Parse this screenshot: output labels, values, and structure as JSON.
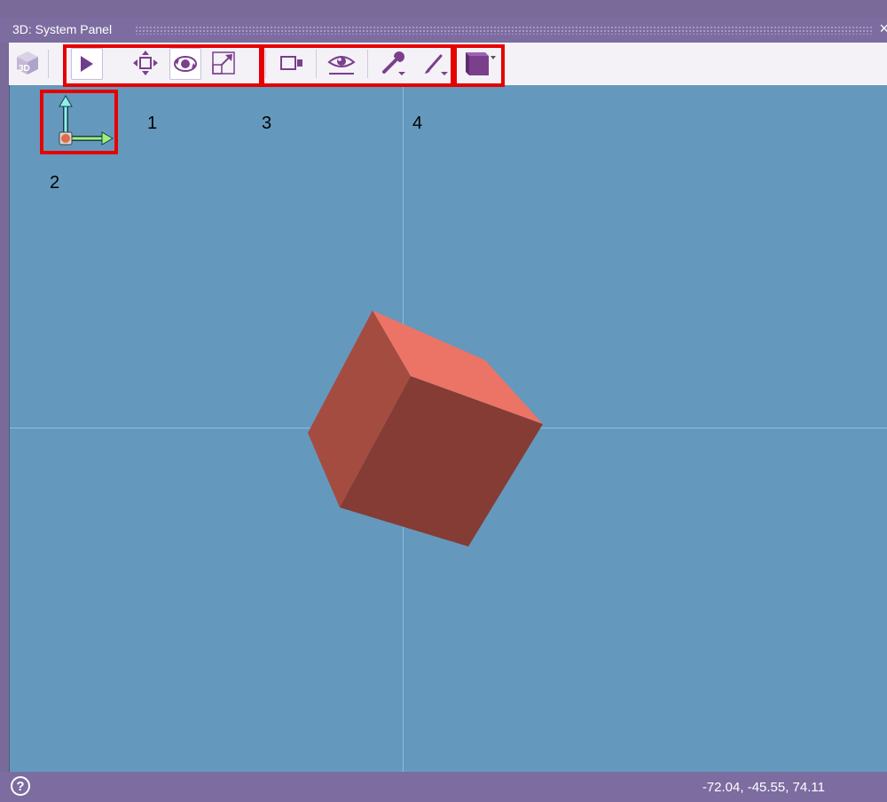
{
  "window": {
    "title": "3D: System Panel",
    "close_glyph": "×"
  },
  "toolbar": {
    "items": [
      {
        "name": "3d-logo-icon"
      },
      {
        "name": "select-arrow-icon"
      },
      {
        "name": "pan-move-icon"
      },
      {
        "name": "orbit-rotate-icon"
      },
      {
        "name": "zoom-scale-icon"
      },
      {
        "name": "camera-icon"
      },
      {
        "name": "eye-view-icon"
      },
      {
        "name": "wrench-tool-icon"
      },
      {
        "name": "brush-paint-icon"
      },
      {
        "name": "cube-display-icon"
      }
    ]
  },
  "callout_labels": [
    "1",
    "2",
    "3",
    "4"
  ],
  "status": {
    "help_glyph": "?",
    "coordinates": "-72.04, -45.55, 74.11"
  },
  "colors": {
    "panel": "#7c6ca0",
    "viewport": "#6598bd",
    "grid": "#86bfe0",
    "cube_top": "#ec7466",
    "cube_left": "#a44c40",
    "cube_front": "#843c34",
    "callout": "#e60000",
    "icon": "#7b3f8c"
  }
}
